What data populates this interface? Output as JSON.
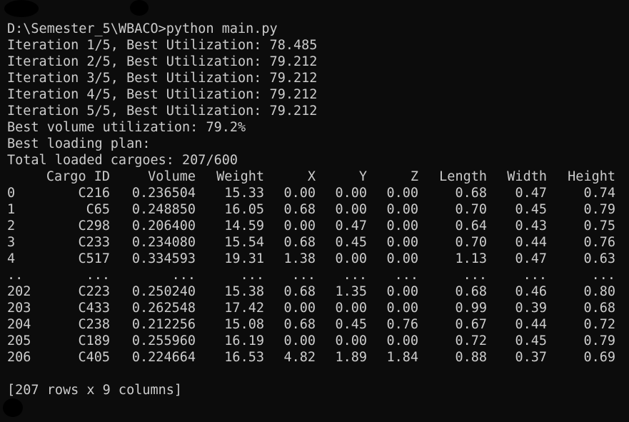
{
  "command_line": "D:\\Semester_5\\WBACO>python main.py",
  "iterations": [
    "Iteration 1/5, Best Utilization: 78.485",
    "Iteration 2/5, Best Utilization: 79.212",
    "Iteration 3/5, Best Utilization: 79.212",
    "Iteration 4/5, Best Utilization: 79.212",
    "Iteration 5/5, Best Utilization: 79.212"
  ],
  "summary": {
    "best_volume": "Best volume utilization: 79.2%",
    "best_plan": "Best loading plan:",
    "total_loaded": "Total loaded cargoes: 207/600"
  },
  "table": {
    "headers": [
      "",
      "Cargo ID",
      "Volume",
      "Weight",
      "X",
      "Y",
      "Z",
      "Length",
      "Width",
      "Height"
    ],
    "rows": [
      [
        "0",
        "C216",
        "0.236504",
        "15.33",
        "0.00",
        "0.00",
        "0.00",
        "0.68",
        "0.47",
        "0.74"
      ],
      [
        "1",
        "C65",
        "0.248850",
        "16.05",
        "0.68",
        "0.00",
        "0.00",
        "0.70",
        "0.45",
        "0.79"
      ],
      [
        "2",
        "C298",
        "0.206400",
        "14.59",
        "0.00",
        "0.47",
        "0.00",
        "0.64",
        "0.43",
        "0.75"
      ],
      [
        "3",
        "C233",
        "0.234080",
        "15.54",
        "0.68",
        "0.45",
        "0.00",
        "0.70",
        "0.44",
        "0.76"
      ],
      [
        "4",
        "C517",
        "0.334593",
        "19.31",
        "1.38",
        "0.00",
        "0.00",
        "1.13",
        "0.47",
        "0.63"
      ],
      [
        "..",
        "...",
        "...",
        "...",
        "...",
        "...",
        "...",
        "...",
        "...",
        "..."
      ],
      [
        "202",
        "C223",
        "0.250240",
        "15.38",
        "0.68",
        "1.35",
        "0.00",
        "0.68",
        "0.46",
        "0.80"
      ],
      [
        "203",
        "C433",
        "0.262548",
        "17.42",
        "0.00",
        "0.00",
        "0.00",
        "0.99",
        "0.39",
        "0.68"
      ],
      [
        "204",
        "C238",
        "0.212256",
        "15.08",
        "0.68",
        "0.45",
        "0.76",
        "0.67",
        "0.44",
        "0.72"
      ],
      [
        "205",
        "C189",
        "0.255960",
        "16.19",
        "0.00",
        "0.00",
        "0.00",
        "0.72",
        "0.45",
        "0.79"
      ],
      [
        "206",
        "C405",
        "0.224664",
        "16.53",
        "4.82",
        "1.89",
        "1.84",
        "0.88",
        "0.37",
        "0.69"
      ]
    ],
    "footer": "[207 rows x 9 columns]"
  },
  "colors": {
    "background": "#0c0c0c",
    "text": "#cccccc"
  }
}
